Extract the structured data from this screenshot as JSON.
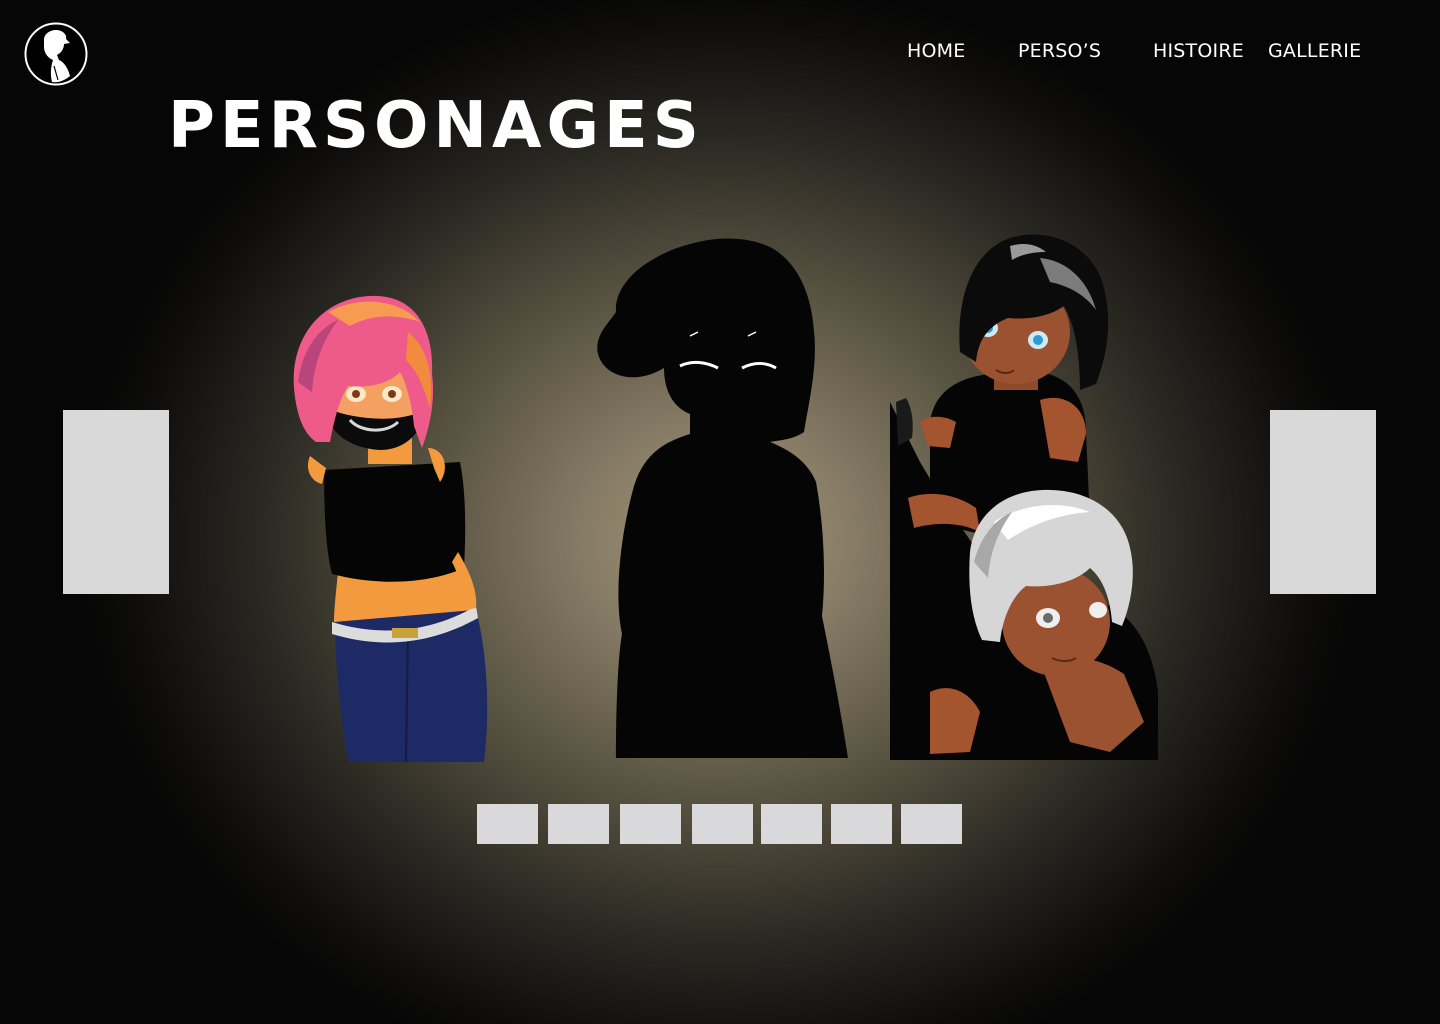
{
  "logo": {
    "icon": "silhouette-logo-icon"
  },
  "nav": {
    "items": [
      {
        "label": "HOME"
      },
      {
        "label": "PERSO’S"
      },
      {
        "label": "HISTOIRE"
      },
      {
        "label": "GALLERIE"
      }
    ]
  },
  "page_title": "PERSONAGES",
  "carousel": {
    "prev_icon": "carousel-prev-arrow-icon",
    "next_icon": "carousel-next-arrow-icon",
    "characters": [
      {
        "name": "pink-hair-character"
      },
      {
        "name": "mystery-silhouette-character"
      },
      {
        "name": "duo-black-and-silver-hair-characters"
      }
    ],
    "slide_count": 7
  },
  "colors": {
    "text": "#ffffff",
    "placeholder": "#d9d9d9",
    "background_center": "#a39579",
    "background_edge": "#060606"
  }
}
